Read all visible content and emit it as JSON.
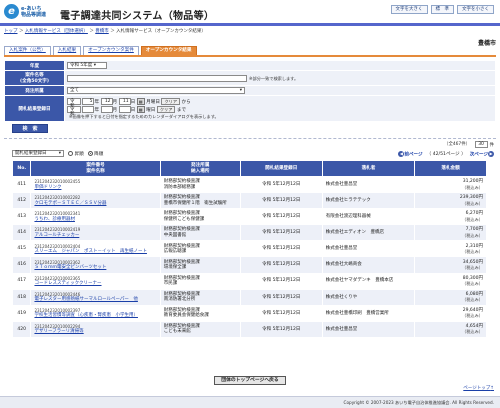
{
  "header": {
    "logo_mark": "e",
    "logo_line1": "e-あいち",
    "logo_line2": "物品等調達",
    "title": "電子調達共同システム（物品等）",
    "font_buttons": [
      "文字を大きく",
      "標　準",
      "文字を小さく"
    ]
  },
  "breadcrumb": {
    "items": [
      "トップ",
      "入札情報サービス（団体選択）",
      "豊橋市",
      "入札情報サービス（オープンカウンタ結果）"
    ],
    "separator": "＞"
  },
  "region": "豊橋市",
  "tabs": [
    {
      "label": "入札案件（公告）",
      "active": false
    },
    {
      "label": "入札結果",
      "active": false
    },
    {
      "label": "オープンカウンタ案件",
      "active": false
    },
    {
      "label": "オープンカウンタ結果",
      "active": true
    }
  ],
  "search": {
    "year_label": "年度",
    "year_value": "令和 5年度",
    "name_label": "案件名等",
    "name_label2": "(全角50文字)",
    "name_value": "",
    "name_note": "※部分一致で検索します。",
    "org_label": "発注所属",
    "org_value": "全て",
    "date_label": "開札結果登録日",
    "from": {
      "era": "令和",
      "year": "5",
      "year_unit": "年",
      "month": "12",
      "month_unit": "月",
      "day": "11",
      "day_unit": "日",
      "dow": "月曜日",
      "clear": "クリア",
      "suffix": "から"
    },
    "to": {
      "era": "令和",
      "year": "",
      "year_unit": "年",
      "month": "",
      "month_unit": "月",
      "day": "",
      "day_unit": "日",
      "dow": "曜日",
      "clear": "クリア",
      "suffix": "まで"
    },
    "cal_icon": "calendar-icon",
    "date_note": "※画像を押下すると日付を指定するためのカレンダーダイアログを表示します。",
    "button": "検　索"
  },
  "listing": {
    "sort_field": "開札結果登録日",
    "asc_label": "昇順",
    "desc_label": "降順",
    "sort_order": "desc",
    "count_text": "（全467件）",
    "perpage_value": "30",
    "perpage_unit": "件",
    "page_text": "（ 42/51ページ ）",
    "prev_label": "前ページ",
    "next_label": "次ページ"
  },
  "table": {
    "headers": {
      "no": "No.",
      "case": "案件番号\n案件名称",
      "org": "発注所属\n納入場所",
      "date": "開札結果登録日",
      "winner": "落札者",
      "amount": "落札金額"
    },
    "rows": [
      {
        "no": "411",
        "case_no": "231204232010002455",
        "case_name": "単価ドリンク",
        "org": "財務部契約検査課",
        "place": "消防本部総務課",
        "date": "令和 5年12月12日",
        "winner": "株式会社豊昌堂",
        "amount": "31,200円",
        "tax": "（税込み）"
      },
      {
        "no": "412",
        "case_no": "231204232010002282",
        "case_name": "クロモテポ－ＳＴＥＣ／ＳＳＶ分器",
        "org": "財務部契約検査課",
        "place": "豊橋市保健所１階　衛生試験所",
        "date": "令和 5年12月12日",
        "winner": "株式会社ヒラテテック",
        "amount": "239,300円",
        "tax": "（税込み）"
      },
      {
        "no": "413",
        "case_no": "231204232010002341",
        "case_name": "うちわ、診療用器材",
        "org": "財務部契約検査課",
        "place": "保健所こども保健課",
        "date": "令和 5年12月12日",
        "winner": "有限会社渡辺理科器械",
        "amount": "6,270円",
        "tax": "（税込み）"
      },
      {
        "no": "414",
        "case_no": "231204232010002419",
        "case_name": "アルコールチェッカー",
        "org": "財務部契約検査課",
        "place": "中央図書館",
        "date": "令和 5年12月12日",
        "winner": "株式会社エディオン　豊橋店",
        "amount": "7,700円",
        "tax": "（税込み）"
      },
      {
        "no": "415",
        "case_no": "231204232010002404",
        "case_name": "スリーエム　ジャパン　ポスト－イット　再生紙ノート",
        "org": "財務部契約検査課",
        "place": "広報広聴課",
        "date": "令和 5年12月12日",
        "winner": "株式会社豊昌堂",
        "amount": "2,310円",
        "tax": "（税込み）"
      },
      {
        "no": "416",
        "case_no": "231204232010002362",
        "case_name": "ＳＴｏｍｍ電安全ピンバーツセット",
        "org": "財務部契約検査課",
        "place": "環境保全課",
        "date": "令和 5年12月12日",
        "winner": "株式会社大嶋商会",
        "amount": "34,650円",
        "tax": "（税込み）"
      },
      {
        "no": "417",
        "case_no": "231204232010002365",
        "case_name": "コードレススティッククリーナー",
        "org": "財務部契約検査課",
        "place": "市民課",
        "date": "令和 5年12月12日",
        "winner": "株式会社ヤマダデンキ　豊橋本店",
        "amount": "80,300円",
        "tax": "（税込み）"
      },
      {
        "no": "418",
        "case_no": "231204232010002446",
        "case_name": "電子レスター用感熱紙サーマルロールペーパー　他",
        "org": "財務部契約検査課",
        "place": "南消防署北分所",
        "date": "令和 5年12月12日",
        "winner": "株式会社くりや",
        "amount": "6,080円",
        "tax": "（税込み）"
      },
      {
        "no": "419",
        "case_no": "231204232010002397",
        "case_name": "学校生活習慣等調査（心疾患・腎疾患　小学生用）",
        "org": "財務部契約検査課",
        "place": "教育委員会保健給食課",
        "date": "令和 5年12月12日",
        "winner": "株式会社豊橋印刷　豊橋営業所",
        "amount": "29,640円",
        "tax": "（税込み）"
      },
      {
        "no": "420",
        "case_no": "231204232010002294",
        "case_name": "デザリーフラーリ清掃等",
        "org": "財務部契約検査課",
        "place": "こども未来館",
        "date": "令和 5年12月12日",
        "winner": "株式会社豊昌堂",
        "amount": "4,654円",
        "tax": "（税込み）"
      }
    ]
  },
  "bottom_button": "団体のトップページへ戻る",
  "page_top": "ページトップ",
  "copyright": "Copyright © 2007-2023 あいち電子自治体推進協議会. All Rights Reserved."
}
